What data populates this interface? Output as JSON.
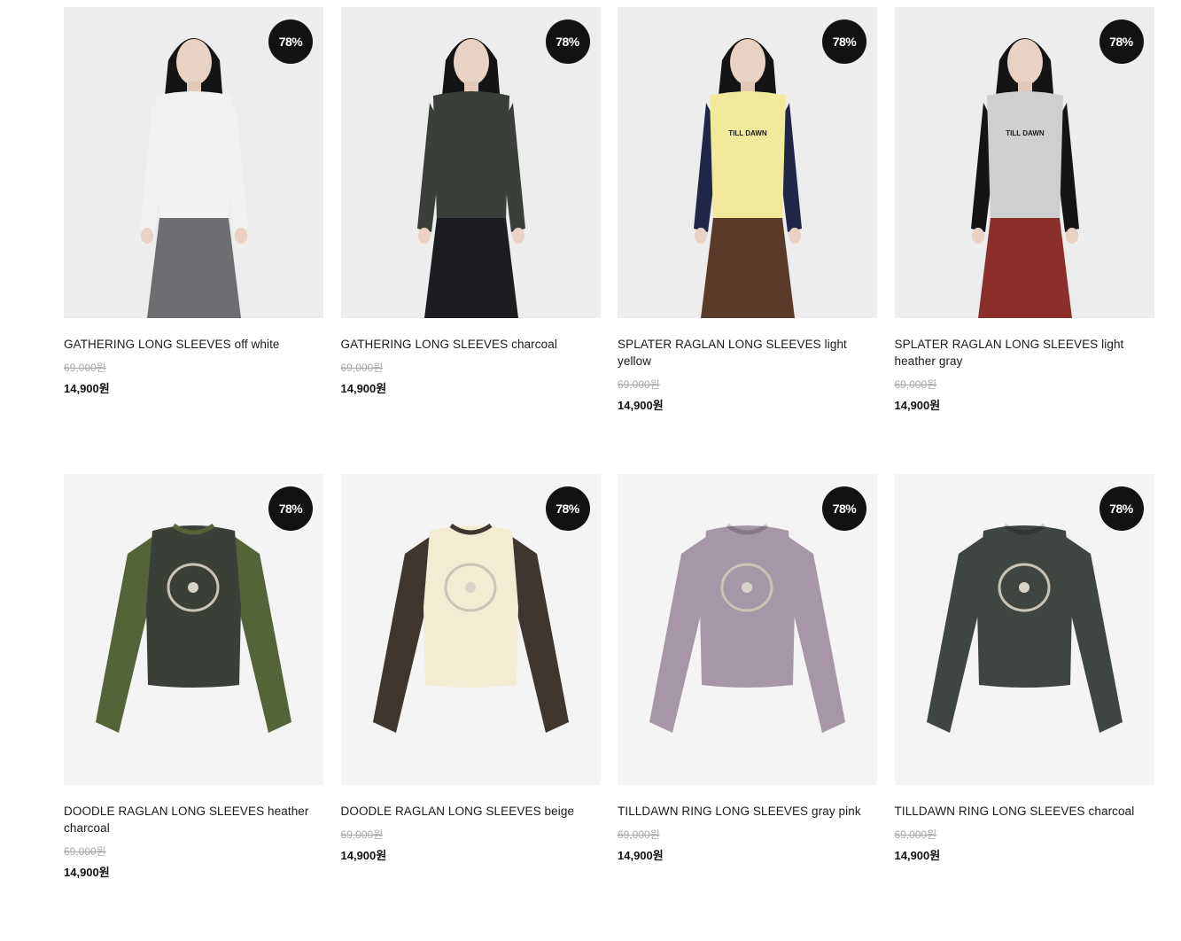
{
  "products": [
    {
      "name": "GATHERING LONG SLEEVES off white",
      "original_price": "69,000원",
      "sale_price": "14,900원",
      "discount": "78%"
    },
    {
      "name": "GATHERING LONG SLEEVES charcoal",
      "original_price": "69,000원",
      "sale_price": "14,900원",
      "discount": "78%"
    },
    {
      "name": "SPLATER RAGLAN LONG SLEEVES light yellow",
      "original_price": "69,000원",
      "sale_price": "14,900원",
      "discount": "78%"
    },
    {
      "name": "SPLATER RAGLAN LONG SLEEVES light heather gray",
      "original_price": "69,000원",
      "sale_price": "14,900원",
      "discount": "78%"
    },
    {
      "name": "DOODLE RAGLAN LONG SLEEVES heather charcoal",
      "original_price": "69,000원",
      "sale_price": "14,900원",
      "discount": "78%"
    },
    {
      "name": "DOODLE RAGLAN LONG SLEEVES beige",
      "original_price": "69,000원",
      "sale_price": "14,900원",
      "discount": "78%"
    },
    {
      "name": "TILLDAWN RING LONG SLEEVES gray pink",
      "original_price": "69,000원",
      "sale_price": "14,900원",
      "discount": "78%"
    },
    {
      "name": "TILLDAWN RING LONG SLEEVES charcoal",
      "original_price": "69,000원",
      "sale_price": "14,900원",
      "discount": "78%"
    }
  ],
  "images": [
    {
      "icon": "model-photo",
      "body": "#f2f2f0",
      "sleeve": "#f2f2f0",
      "bottom": "#6e6e72"
    },
    {
      "icon": "model-photo",
      "body": "#3b3f39",
      "sleeve": "#3b3f39",
      "bottom": "#1c1d21"
    },
    {
      "icon": "model-photo",
      "body": "#f3e99a",
      "sleeve": "#1f2647",
      "bottom": "#5a3a28",
      "print": "TILL DAWN"
    },
    {
      "icon": "model-photo",
      "body": "#cfcfd1",
      "sleeve": "#141414",
      "bottom": "#8a2f2a",
      "print": "TILL DAWN"
    },
    {
      "icon": "product-photo",
      "body": "#3a3f38",
      "sleeve": "#556338"
    },
    {
      "icon": "product-photo",
      "body": "#f1ecd2",
      "sleeve": "#3f362e"
    },
    {
      "icon": "product-photo",
      "body": "#a797a6",
      "sleeve": "#a797a6"
    },
    {
      "icon": "product-photo",
      "body": "#3f4540",
      "sleeve": "#3f4540"
    }
  ]
}
